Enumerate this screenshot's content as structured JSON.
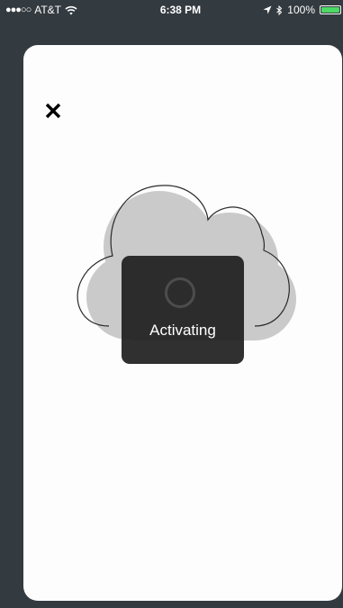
{
  "status_bar": {
    "signal": "●●●○○",
    "carrier": "AT&T",
    "time": "6:38 PM",
    "battery": "100%",
    "battery_level": 1.0,
    "battery_color": "#4cd964",
    "icons": [
      "wifi-icon",
      "location-arrow-icon",
      "bluetooth-icon",
      "battery-icon"
    ]
  },
  "modal": {
    "close_icon": "close-icon",
    "illustration": "cloud-icon"
  },
  "hud": {
    "label": "Activating",
    "spinner": "spinner-icon"
  },
  "colors": {
    "background": "#333a40",
    "card": "#fdfdfd",
    "cloud_fill": "#cccccc",
    "hud": "#1e1e1e"
  }
}
